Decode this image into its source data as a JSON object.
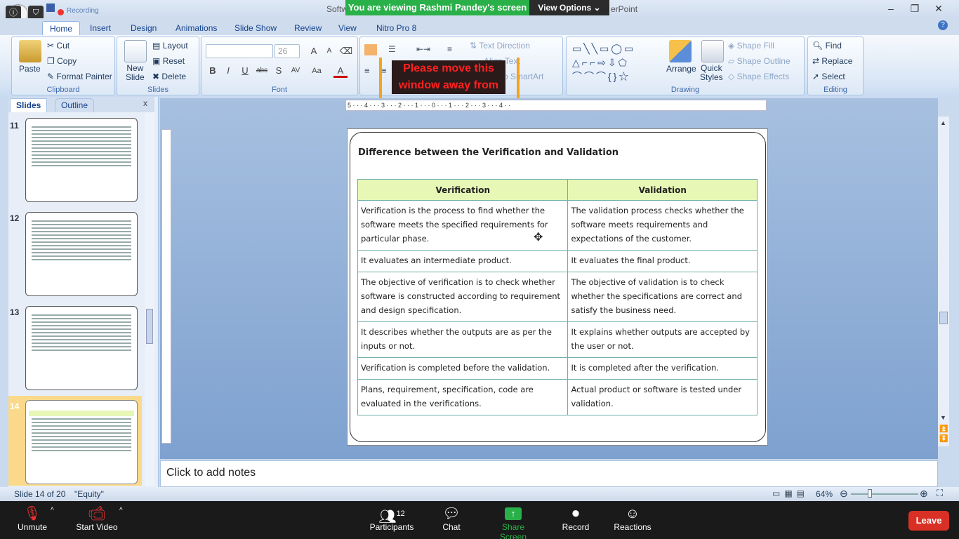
{
  "window": {
    "title_left": "Softw",
    "title_right": "erPoint",
    "min": "–",
    "max": "❐",
    "close": "✕"
  },
  "zoom_banner": {
    "viewing": "You are viewing Rashmi Pandey's screen",
    "view_options": "View Options ⌄",
    "recording": "Recording"
  },
  "tabs": [
    "Home",
    "Insert",
    "Design",
    "Animations",
    "Slide Show",
    "Review",
    "View",
    "Nitro Pro 8"
  ],
  "clipboard": {
    "paste": "Paste",
    "cut": "Cut",
    "copy": "Copy",
    "format_painter": "Format Painter",
    "label": "Clipboard"
  },
  "slides_group": {
    "new_slide": "New",
    "new_slide2": "Slide",
    "layout": "Layout",
    "reset": "Reset",
    "delete": "Delete",
    "label": "Slides"
  },
  "font_group": {
    "size": "26",
    "label": "Font",
    "bold": "B",
    "italic": "I",
    "underline": "U",
    "strike": "abc",
    "shadow": "S",
    "spacing": "AV",
    "case": "Aa",
    "color": "A",
    "grow": "A",
    "shrink": "A"
  },
  "paragraph_group": {
    "text_direction": "Text Direction",
    "align_text": "Align Text",
    "smartart": "rt to SmartArt"
  },
  "drawing_group": {
    "arrange": "Arrange",
    "quick_styles": "Quick",
    "quick_styles2": "Styles",
    "shape_fill": "Shape Fill",
    "shape_outline": "Shape Outline",
    "shape_effects": "Shape Effects",
    "label": "Drawing"
  },
  "editing_group": {
    "find": "Find",
    "replace": "Replace",
    "select": "Select",
    "label": "Editing"
  },
  "warning": {
    "line1": "Please move this",
    "line2": "window away from"
  },
  "left_panel": {
    "tab_slides": "Slides",
    "tab_outline": "Outline",
    "close": "x",
    "thumb_numbers": [
      "11",
      "12",
      "13",
      "14"
    ]
  },
  "ruler": {
    "h": "5 · · · 4 · · · 3 · · · 2 · · · 1 · · · 0 · · · 1 · · · 2 · · · 3 · · · 4 · ·"
  },
  "slide": {
    "title": "Difference between the Verification and Validation",
    "headers": [
      "Verification",
      "Validation"
    ],
    "rows": [
      [
        "Verification is the process to find whether the software meets the specified requirements for particular phase.",
        "The validation process checks whether the software meets requirements and expectations of the customer."
      ],
      [
        "It evaluates an intermediate product.",
        "It evaluates the final product."
      ],
      [
        "The objective of verification is to check whether software is constructed according to requirement and design specification.",
        "The objective of validation is to check whether the specifications are correct and satisfy the business need."
      ],
      [
        "It describes whether the outputs are as per the inputs or not.",
        "It explains whether outputs are accepted by the user or not."
      ],
      [
        "Verification is completed before the validation.",
        "It is completed after the verification."
      ],
      [
        "Plans, requirement, specification, code are evaluated in the verifications.",
        "Actual product or software is tested under validation."
      ]
    ]
  },
  "notes": {
    "placeholder": "Click to add notes"
  },
  "status": {
    "slide": "Slide 14 of 20",
    "theme": "\"Equity\"",
    "zoom": "64%"
  },
  "zoom_controls": {
    "unmute": "Unmute",
    "start_video": "Start Video",
    "participants": "Participants",
    "participants_count": "12",
    "chat": "Chat",
    "share": "Share Screen",
    "record": "Record",
    "reactions": "Reactions",
    "leave": "Leave"
  },
  "colors": {
    "share_green": "#2ab049",
    "leave_red": "#d93025",
    "ribbon_blue": "#15428b",
    "table_header": "#e6f7b6",
    "table_border": "#6fb0a8"
  }
}
